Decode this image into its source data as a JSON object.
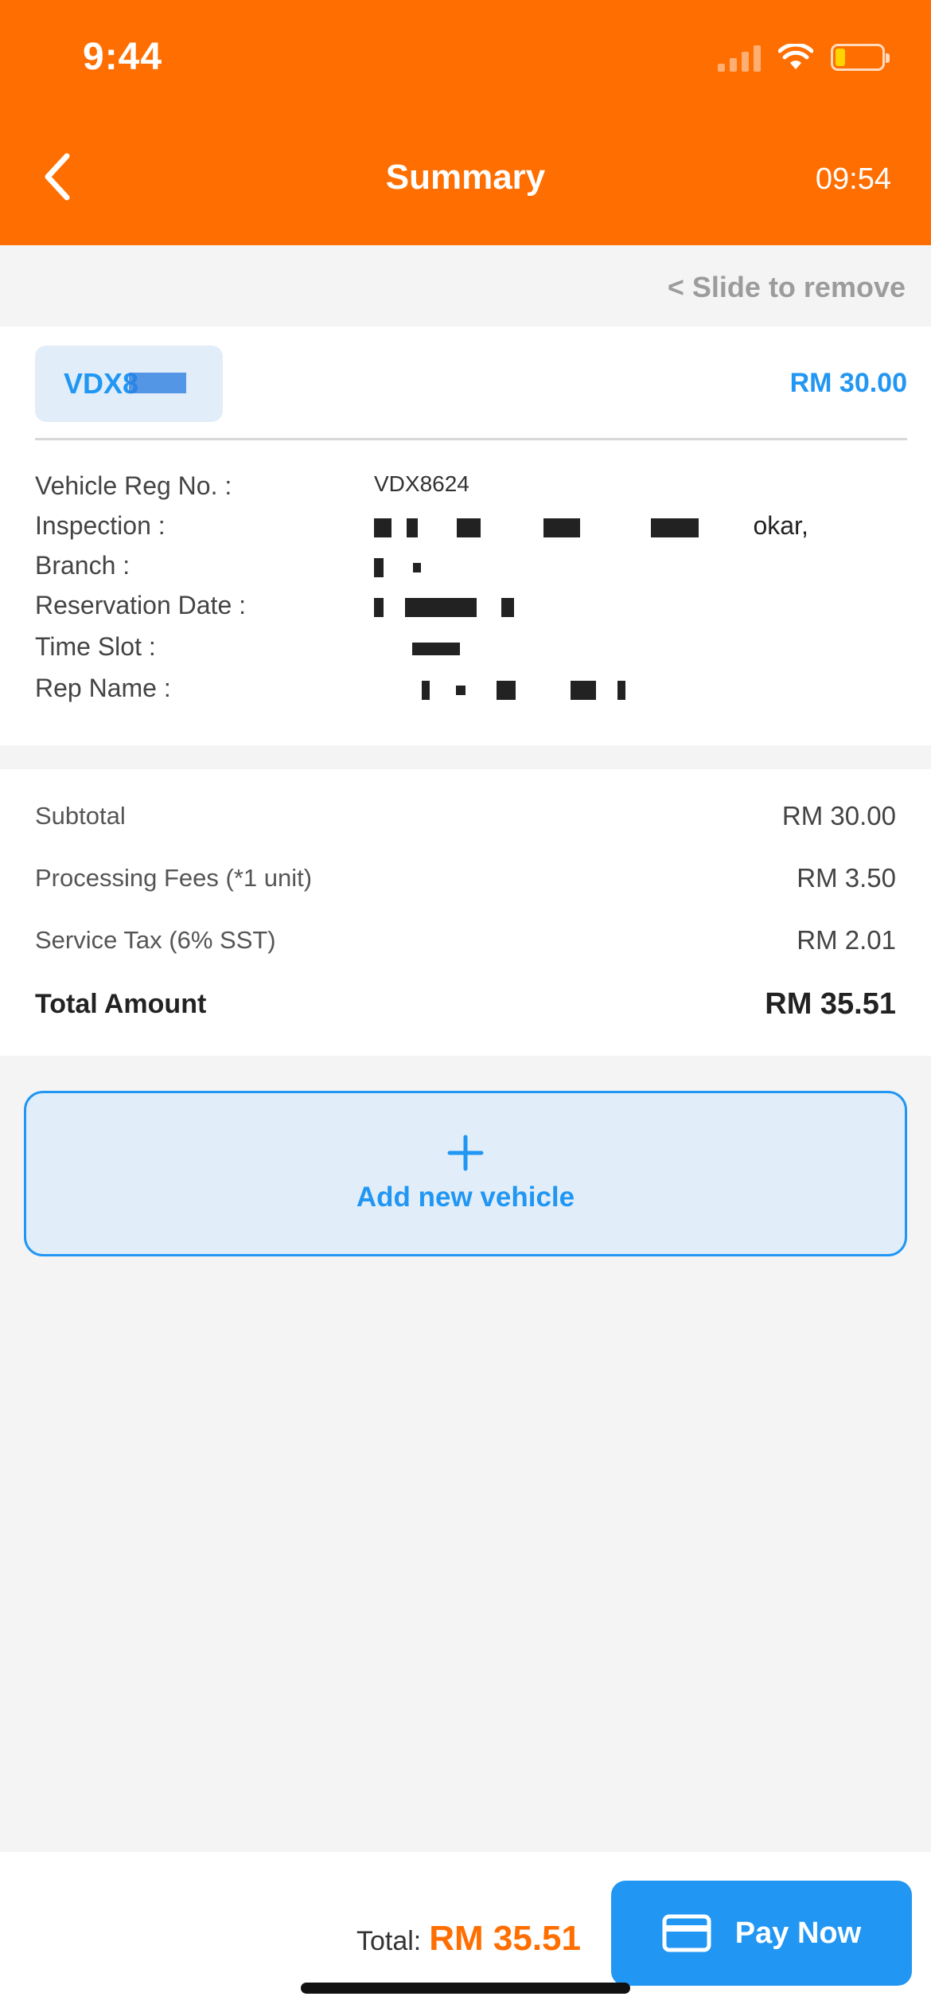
{
  "status_bar": {
    "time": "9:44"
  },
  "header": {
    "title": "Summary",
    "timer": "09:54"
  },
  "slide_hint": "<  Slide to remove",
  "vehicle_card": {
    "plate_chip": "VDX8",
    "price": "RM 30.00",
    "details": [
      {
        "label": "Vehicle Reg No. :",
        "value": "VDX8624"
      },
      {
        "label": "Inspection :",
        "value": "okar,"
      },
      {
        "label": "Branch :",
        "value": ""
      },
      {
        "label": "Reservation Date :",
        "value": ""
      },
      {
        "label": "Time Slot :",
        "value": ""
      },
      {
        "label": "Rep Name :",
        "value": ""
      }
    ]
  },
  "summary": {
    "subtotal_label": "Subtotal",
    "subtotal_value": "RM 30.00",
    "processing_label": "Processing Fees (*1 unit)",
    "processing_value": "RM 3.50",
    "tax_label": "Service Tax (6% SST)",
    "tax_value": "RM 2.01",
    "total_label": "Total Amount",
    "total_value": "RM 35.51"
  },
  "add_vehicle": {
    "icon": "plus-icon",
    "label": "Add new vehicle"
  },
  "footer": {
    "total_label": "Total:",
    "total_value": "RM 35.51",
    "pay_label": "Pay Now",
    "pay_icon": "credit-card-icon"
  },
  "colors": {
    "brand": "#ff6e00",
    "accent": "#2196f3"
  }
}
